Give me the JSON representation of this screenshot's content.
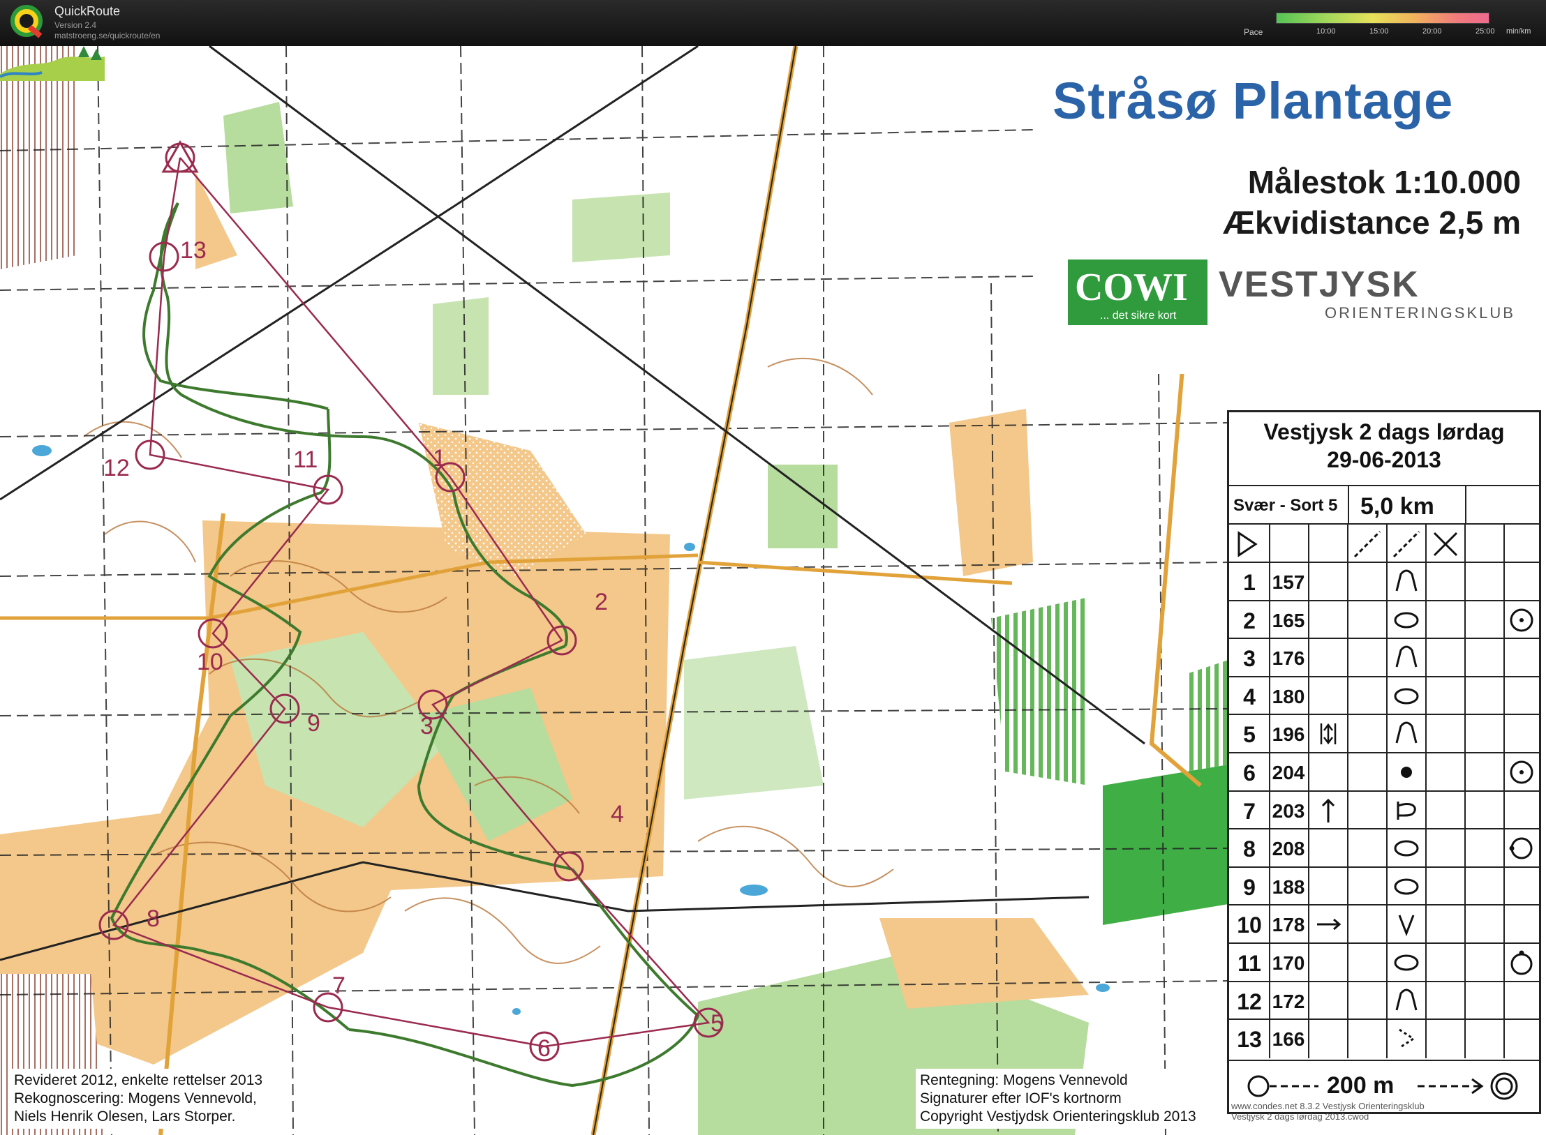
{
  "app": {
    "name": "QuickRoute",
    "version": "Version 2.4",
    "url": "matstroeng.se/quickroute/en"
  },
  "pace": {
    "label": "Pace",
    "ticks": [
      "10:00",
      "15:00",
      "20:00",
      "25:00"
    ],
    "unit": "min/km"
  },
  "map": {
    "title": "Stråsø Plantage",
    "scale": "Målestok 1:10.000",
    "equidistance": "Ækvidistance 2,5 m",
    "sponsor": {
      "name": "COWI",
      "tagline": "... det sikre kort"
    },
    "club": {
      "name": "VESTJYSK",
      "sub": "ORIENTERINGSKLUB"
    },
    "colors": {
      "open": "#f3c88a",
      "forest_green": "#9fd28c",
      "dark_green": "#3fae45",
      "course": "#9a2a4e",
      "route": "#3d7a2e",
      "contour": "#b9763a"
    },
    "controls": [
      {
        "label": "1"
      },
      {
        "label": "2"
      },
      {
        "label": "3"
      },
      {
        "label": "4"
      },
      {
        "label": "5"
      },
      {
        "label": "6"
      },
      {
        "label": "7"
      },
      {
        "label": "8"
      },
      {
        "label": "9"
      },
      {
        "label": "10"
      },
      {
        "label": "11"
      },
      {
        "label": "12"
      },
      {
        "label": "13"
      }
    ],
    "revision_lines": [
      "Revideret 2012, enkelte rettelser 2013",
      "Rekognoscering: Mogens Vennevold,",
      "Niels Henrik Olesen, Lars Storper."
    ],
    "drawing_lines": [
      "Rentegning: Mogens Vennevold",
      "Signaturer efter IOF's kortnorm",
      "Copyright Vestjydsk Orienteringsklub 2013"
    ],
    "condes_lines": [
      "www.condes.net 8.3.2 Vestjysk Orienteringsklub",
      "Vestjysk 2 dags lørdag 2013.cwod"
    ]
  },
  "description": {
    "event": "Vestjysk 2 dags lørdag",
    "date": "29-06-2013",
    "category": "Svær - Sort 5",
    "length": "5,0 km",
    "rows": [
      {
        "num": "1",
        "code": "157",
        "dir": "",
        "feature": "knoll",
        "appearance": ""
      },
      {
        "num": "2",
        "code": "165",
        "dir": "",
        "feature": "depression",
        "appearance": "foot"
      },
      {
        "num": "3",
        "code": "176",
        "dir": "",
        "feature": "knoll",
        "appearance": ""
      },
      {
        "num": "4",
        "code": "180",
        "dir": "",
        "feature": "depression",
        "appearance": ""
      },
      {
        "num": "5",
        "code": "196",
        "dir": "between",
        "feature": "knoll",
        "appearance": ""
      },
      {
        "num": "6",
        "code": "204",
        "dir": "",
        "feature": "boulder",
        "appearance": "foot"
      },
      {
        "num": "7",
        "code": "203",
        "dir": "north",
        "feature": "spur",
        "appearance": ""
      },
      {
        "num": "8",
        "code": "208",
        "dir": "",
        "feature": "depression",
        "appearance": "side"
      },
      {
        "num": "9",
        "code": "188",
        "dir": "",
        "feature": "depression",
        "appearance": ""
      },
      {
        "num": "10",
        "code": "178",
        "dir": "east",
        "feature": "gully",
        "appearance": ""
      },
      {
        "num": "11",
        "code": "170",
        "dir": "",
        "feature": "depression",
        "appearance": "top"
      },
      {
        "num": "12",
        "code": "172",
        "dir": "",
        "feature": "knoll",
        "appearance": ""
      },
      {
        "num": "13",
        "code": "166",
        "dir": "",
        "feature": "corner",
        "appearance": ""
      }
    ],
    "finish_text": "200 m"
  }
}
